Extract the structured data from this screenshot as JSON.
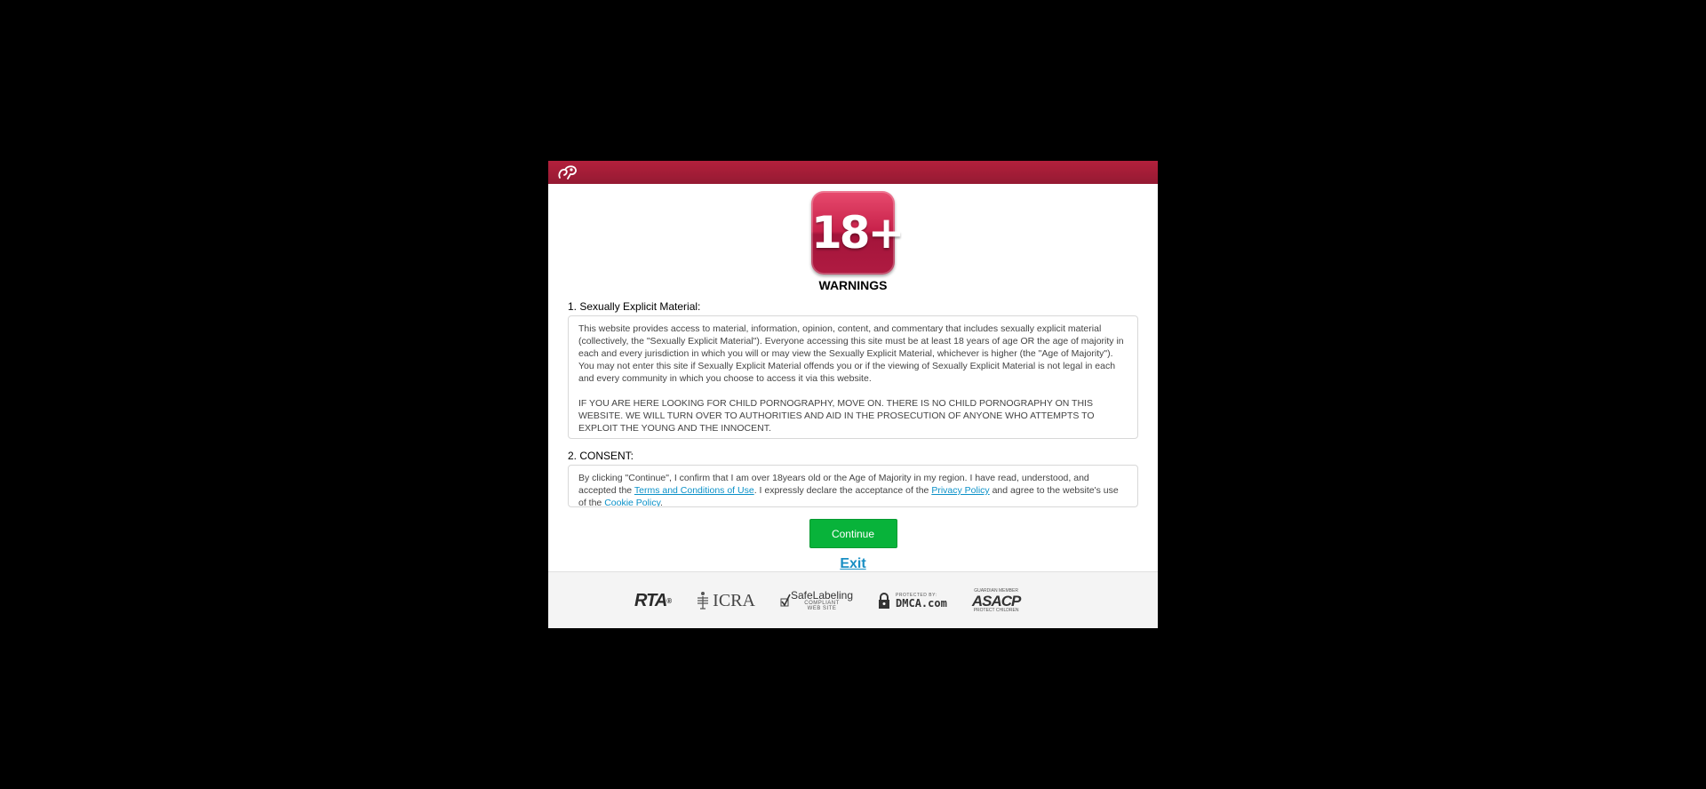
{
  "header": {
    "logo_icon": "brand-logo-icon"
  },
  "badge": {
    "text": "18+",
    "color": "#c7214a"
  },
  "warnings_title": "WARNINGS",
  "section1": {
    "label": "1. Sexually Explicit Material:",
    "paragraph1": "This website provides access to material, information, opinion, content, and commentary that includes sexually explicit material (collectively, the \"Sexually Explicit Material\"). Everyone accessing this site must be at least 18 years of age OR the age of majority in each and every jurisdiction in which you will or may view the Sexually Explicit Material, whichever is higher (the \"Age of Majority\"). You may not enter this site if Sexually Explicit Material offends you or if the viewing of Sexually Explicit Material is not legal in each and every community in which you choose to access it via this website.",
    "paragraph2": "IF YOU ARE HERE LOOKING FOR CHILD PORNOGRAPHY, MOVE ON. THERE IS NO CHILD PORNOGRAPHY ON THIS WEBSITE. WE WILL TURN OVER TO AUTHORITIES AND AID IN THE PROSECUTION OF ANYONE WHO ATTEMPTS TO EXPLOIT THE YOUNG AND THE INNOCENT."
  },
  "section2": {
    "label": "2. CONSENT:",
    "text_part1": "By clicking \"Continue\", I confirm that I am over 18years old or the Age of Majority in my region. I have read, understood, and accepted the ",
    "terms_link": "Terms and Conditions of Use",
    "text_part2": ". I expressly declare the acceptance of the ",
    "privacy_link": "Privacy Policy",
    "text_part3": " and agree to the website's use of the ",
    "cookie_link": "Cookie Policy",
    "text_part4": "."
  },
  "actions": {
    "continue_label": "Continue",
    "exit_label": "Exit",
    "continue_color": "#08b33a",
    "exit_color": "#1a8fc4"
  },
  "footer": {
    "rta": "RTA",
    "rta_reg": "®",
    "icra": "ICRA",
    "safelabeling_main": "SafeLabeling",
    "safelabeling_sub1": "COMPLIANT",
    "safelabeling_sub2": "WEB SITE",
    "dmca_sub": "PROTECTED BY:",
    "dmca_main": "DMCA.com",
    "asacp_top": "GUARDIAN MEMBER",
    "asacp_main": "ASACP",
    "asacp_bottom": "PROTECT CHILDREN"
  }
}
